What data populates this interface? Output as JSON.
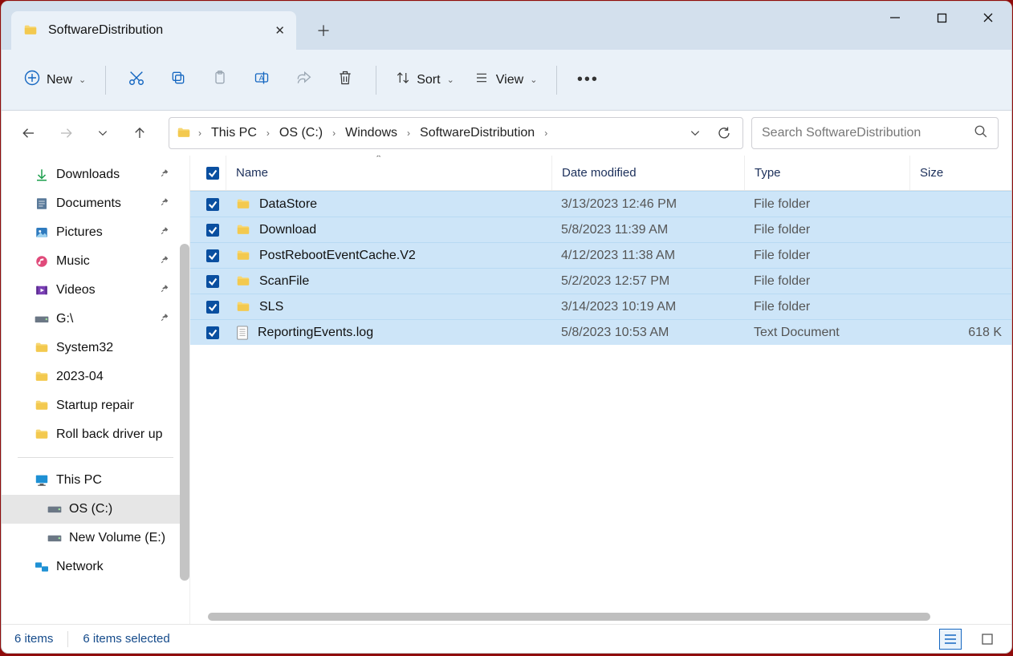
{
  "window": {
    "tab_title": "SoftwareDistribution"
  },
  "toolbar": {
    "new_label": "New",
    "sort_label": "Sort",
    "view_label": "View"
  },
  "breadcrumb": {
    "crumb1": "This PC",
    "crumb2": "OS (C:)",
    "crumb3": "Windows",
    "crumb4": "SoftwareDistribution"
  },
  "search": {
    "placeholder": "Search SoftwareDistribution"
  },
  "sidebar": {
    "items": [
      {
        "label": "Downloads",
        "icon": "download",
        "pinned": true
      },
      {
        "label": "Documents",
        "icon": "doc",
        "pinned": true
      },
      {
        "label": "Pictures",
        "icon": "pic",
        "pinned": true
      },
      {
        "label": "Music",
        "icon": "music",
        "pinned": true
      },
      {
        "label": "Videos",
        "icon": "video",
        "pinned": true
      },
      {
        "label": "G:\\",
        "icon": "drive",
        "pinned": true
      },
      {
        "label": "System32",
        "icon": "folder"
      },
      {
        "label": "2023-04",
        "icon": "folder"
      },
      {
        "label": "Startup repair",
        "icon": "folder"
      },
      {
        "label": "Roll back driver up",
        "icon": "folder"
      }
    ],
    "devices": [
      {
        "label": "This PC",
        "icon": "pc"
      },
      {
        "label": "OS (C:)",
        "icon": "osd",
        "active": true
      },
      {
        "label": "New Volume (E:)",
        "icon": "drive"
      },
      {
        "label": "Network",
        "icon": "net"
      }
    ]
  },
  "columns": {
    "name": "Name",
    "date": "Date modified",
    "type": "Type",
    "size": "Size"
  },
  "rows": [
    {
      "name": "DataStore",
      "date": "3/13/2023 12:46 PM",
      "type": "File folder",
      "size": "",
      "icon": "folder"
    },
    {
      "name": "Download",
      "date": "5/8/2023 11:39 AM",
      "type": "File folder",
      "size": "",
      "icon": "folder"
    },
    {
      "name": "PostRebootEventCache.V2",
      "date": "4/12/2023 11:38 AM",
      "type": "File folder",
      "size": "",
      "icon": "folder"
    },
    {
      "name": "ScanFile",
      "date": "5/2/2023 12:57 PM",
      "type": "File folder",
      "size": "",
      "icon": "folder"
    },
    {
      "name": "SLS",
      "date": "3/14/2023 10:19 AM",
      "type": "File folder",
      "size": "",
      "icon": "folder"
    },
    {
      "name": "ReportingEvents.log",
      "date": "5/8/2023 10:53 AM",
      "type": "Text Document",
      "size": "618 K",
      "icon": "file"
    }
  ],
  "status": {
    "count": "6 items",
    "selected": "6 items selected"
  }
}
